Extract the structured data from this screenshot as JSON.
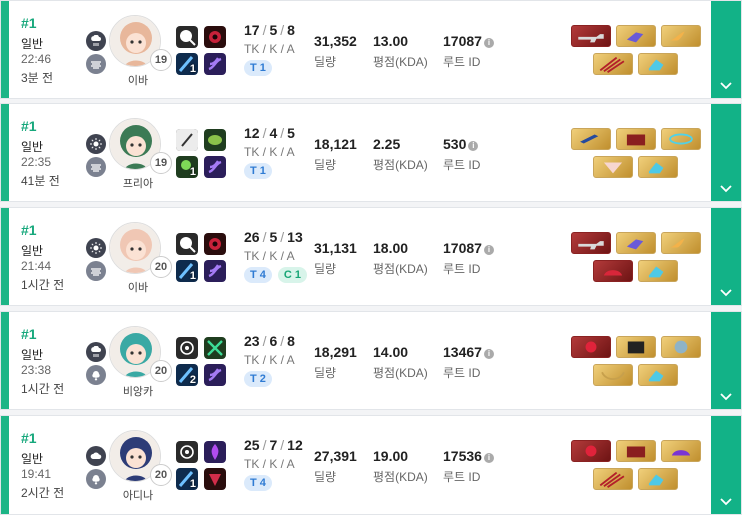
{
  "matches": [
    {
      "rank": "#1",
      "mode": "일반",
      "time": "22:46",
      "ago": "3분 전",
      "weather": [
        "rain-cloud-icon",
        "fog-icon"
      ],
      "character": {
        "name": "이바",
        "level": "19",
        "avatar_color": "#e8b79b"
      },
      "skills": [
        {
          "icon": "magnify-icon",
          "num": ""
        },
        {
          "icon": "red-orb-icon",
          "num": ""
        },
        {
          "icon": "blue-skill-icon",
          "num": "1"
        },
        {
          "icon": "purple-swirl-icon",
          "num": ""
        }
      ],
      "kda": {
        "k": "17",
        "d": "5",
        "a": "8",
        "label": "TK / K / A"
      },
      "tiers": [
        {
          "text": "T 1",
          "kind": "t"
        }
      ],
      "damage": "31,352",
      "damage_label": "딜량",
      "score": "13.00",
      "score_label": "평점(KDA)",
      "route": "17087",
      "route_label": "루트 ID",
      "items": [
        {
          "icon": "gun-icon",
          "color": "red"
        },
        {
          "icon": "arm-guard-icon",
          "color": "gold"
        },
        {
          "icon": "wing-hat-icon",
          "color": "gold"
        },
        {
          "icon": "claw-icon",
          "color": "gold"
        },
        {
          "icon": "boots-icon",
          "color": "gold"
        }
      ]
    },
    {
      "rank": "#1",
      "mode": "일반",
      "time": "22:35",
      "ago": "41분 전",
      "weather": [
        "sun-icon",
        "fog-icon"
      ],
      "character": {
        "name": "프리아",
        "level": "19",
        "avatar_color": "#3c7a55"
      },
      "skills": [
        {
          "icon": "guitar-icon",
          "num": ""
        },
        {
          "icon": "green-leaf-icon",
          "num": ""
        },
        {
          "icon": "green-skill-icon",
          "num": "1"
        },
        {
          "icon": "purple-swirl-icon",
          "num": ""
        }
      ],
      "kda": {
        "k": "12",
        "d": "4",
        "a": "5",
        "label": "TK / K / A"
      },
      "tiers": [
        {
          "text": "T 1",
          "kind": "t"
        }
      ],
      "damage": "18,121",
      "damage_label": "딜량",
      "score": "2.25",
      "score_label": "평점(KDA)",
      "route": "530",
      "route_label": "루트 ID",
      "items": [
        {
          "icon": "guitar-item-icon",
          "color": "gold"
        },
        {
          "icon": "armor-icon",
          "color": "gold"
        },
        {
          "icon": "bracelet-icon",
          "color": "gold"
        },
        {
          "icon": "fan-icon",
          "color": "gold"
        },
        {
          "icon": "boots-icon",
          "color": "gold"
        }
      ]
    },
    {
      "rank": "#1",
      "mode": "일반",
      "time": "21:44",
      "ago": "1시간 전",
      "weather": [
        "sun-icon",
        "fog-icon"
      ],
      "character": {
        "name": "이바",
        "level": "20",
        "avatar_color": "#f0c7b4"
      },
      "skills": [
        {
          "icon": "magnify-icon",
          "num": ""
        },
        {
          "icon": "red-orb-icon",
          "num": ""
        },
        {
          "icon": "blue-skill-icon",
          "num": "1"
        },
        {
          "icon": "purple-swirl-icon",
          "num": ""
        }
      ],
      "kda": {
        "k": "26",
        "d": "5",
        "a": "13",
        "label": "TK / K / A"
      },
      "tiers": [
        {
          "text": "T 4",
          "kind": "t"
        },
        {
          "text": "C 1",
          "kind": "c"
        }
      ],
      "damage": "31,131",
      "damage_label": "딜량",
      "score": "18.00",
      "score_label": "평점(KDA)",
      "route": "17087",
      "route_label": "루트 ID",
      "items": [
        {
          "icon": "gun-icon",
          "color": "red"
        },
        {
          "icon": "arm-guard-icon",
          "color": "gold"
        },
        {
          "icon": "wing-hat-icon",
          "color": "gold"
        },
        {
          "icon": "red-hat-icon",
          "color": "red"
        },
        {
          "icon": "boots-icon",
          "color": "gold"
        }
      ]
    },
    {
      "rank": "#1",
      "mode": "일반",
      "time": "23:38",
      "ago": "1시간 전",
      "weather": [
        "rain-cloud-icon",
        "wind-icon"
      ],
      "character": {
        "name": "비앙카",
        "level": "20",
        "avatar_color": "#3aa9a4"
      },
      "skills": [
        {
          "icon": "target-icon",
          "num": ""
        },
        {
          "icon": "green-cross-icon",
          "num": ""
        },
        {
          "icon": "blue-skill-icon",
          "num": "2"
        },
        {
          "icon": "purple-swirl-icon",
          "num": ""
        }
      ],
      "kda": {
        "k": "23",
        "d": "6",
        "a": "8",
        "label": "TK / K / A"
      },
      "tiers": [
        {
          "text": "T 2",
          "kind": "t"
        }
      ],
      "damage": "18,291",
      "damage_label": "딜량",
      "score": "14.00",
      "score_label": "평점(KDA)",
      "route": "13467",
      "route_label": "루트 ID",
      "items": [
        {
          "icon": "red-gem-icon",
          "color": "red"
        },
        {
          "icon": "black-armor-icon",
          "color": "gold"
        },
        {
          "icon": "helmet-icon",
          "color": "gold"
        },
        {
          "icon": "necklace-icon",
          "color": "gold"
        },
        {
          "icon": "boots-icon",
          "color": "gold"
        }
      ]
    },
    {
      "rank": "#1",
      "mode": "일반",
      "time": "19:41",
      "ago": "2시간 전",
      "weather": [
        "cloud-icon",
        "wind-icon"
      ],
      "character": {
        "name": "아디나",
        "level": "20",
        "avatar_color": "#2d3c77"
      },
      "skills": [
        {
          "icon": "target-icon",
          "num": ""
        },
        {
          "icon": "purple-flame-icon",
          "num": ""
        },
        {
          "icon": "blue-skill-icon",
          "num": "1"
        },
        {
          "icon": "red-crest-icon",
          "num": ""
        }
      ],
      "kda": {
        "k": "25",
        "d": "7",
        "a": "12",
        "label": "TK / K / A"
      },
      "tiers": [
        {
          "text": "T 4",
          "kind": "t"
        }
      ],
      "damage": "27,391",
      "damage_label": "딜량",
      "score": "19.00",
      "score_label": "평점(KDA)",
      "route": "17536",
      "route_label": "루트 ID",
      "items": [
        {
          "icon": "red-gem-icon",
          "color": "red"
        },
        {
          "icon": "armor-icon",
          "color": "gold"
        },
        {
          "icon": "jewel-hat-icon",
          "color": "gold"
        },
        {
          "icon": "claw-icon",
          "color": "gold"
        },
        {
          "icon": "boots-icon",
          "color": "gold"
        }
      ]
    }
  ],
  "colors": {
    "accent": "#12b287",
    "rank": "#17a87c",
    "tier_bg": "#dbeafb",
    "tier_text": "#2f7bd3"
  }
}
